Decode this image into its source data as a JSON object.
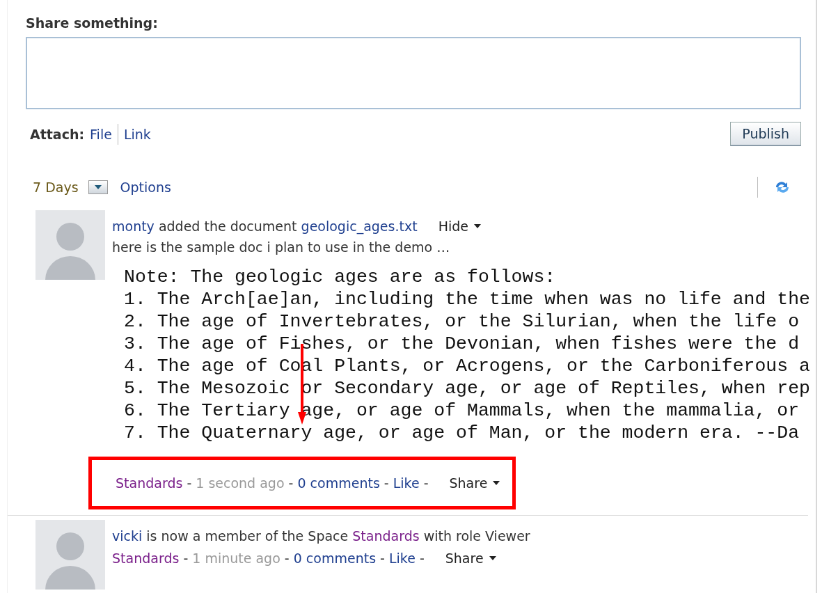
{
  "composer": {
    "label": "Share something:",
    "attach_label": "Attach:",
    "attach_links": [
      "File",
      "Link"
    ],
    "publish": "Publish"
  },
  "filter": {
    "period": "7 Days",
    "options": "Options"
  },
  "feed": [
    {
      "headline": [
        {
          "kind": "user",
          "text": "monty"
        },
        {
          "kind": "plain",
          "text": " added the document "
        },
        {
          "kind": "document",
          "text": "geologic_ages.txt"
        }
      ],
      "menu": "Hide",
      "summary": "here is the sample doc i plan to use in the demo …",
      "document_lines": [
        "Note: The geologic ages are as follows:",
        "1. The Arch[ae]an, including the time when was no life and the",
        "2. The age of Invertebrates, or the Silurian, when the life o",
        "3. The age of Fishes, or the Devonian, when fishes were the d",
        "4. The age of Coal Plants, or Acrogens, or the Carboniferous a",
        "5. The Mesozoic or Secondary age, or age of Reptiles, when rep",
        "6. The Tertiary age, or age of Mammals, when the mammalia, or",
        "7. The Quaternary age, or age of Man, or the modern era. --Da"
      ],
      "separator": "-",
      "space": "Standards",
      "time": "1 second ago",
      "comments": "0 comments",
      "like": "Like",
      "share": "Share",
      "highlighted": true
    },
    {
      "headline": [
        {
          "kind": "user",
          "text": "vicki"
        },
        {
          "kind": "plain",
          "text": " is now a member of the Space "
        },
        {
          "kind": "space",
          "text": "Standards"
        },
        {
          "kind": "plain",
          "text": " with role Viewer"
        }
      ],
      "separator": "-",
      "space": "Standards",
      "time": "1 minute ago",
      "comments": "0 comments",
      "like": "Like",
      "share": "Share",
      "highlighted": false
    }
  ]
}
